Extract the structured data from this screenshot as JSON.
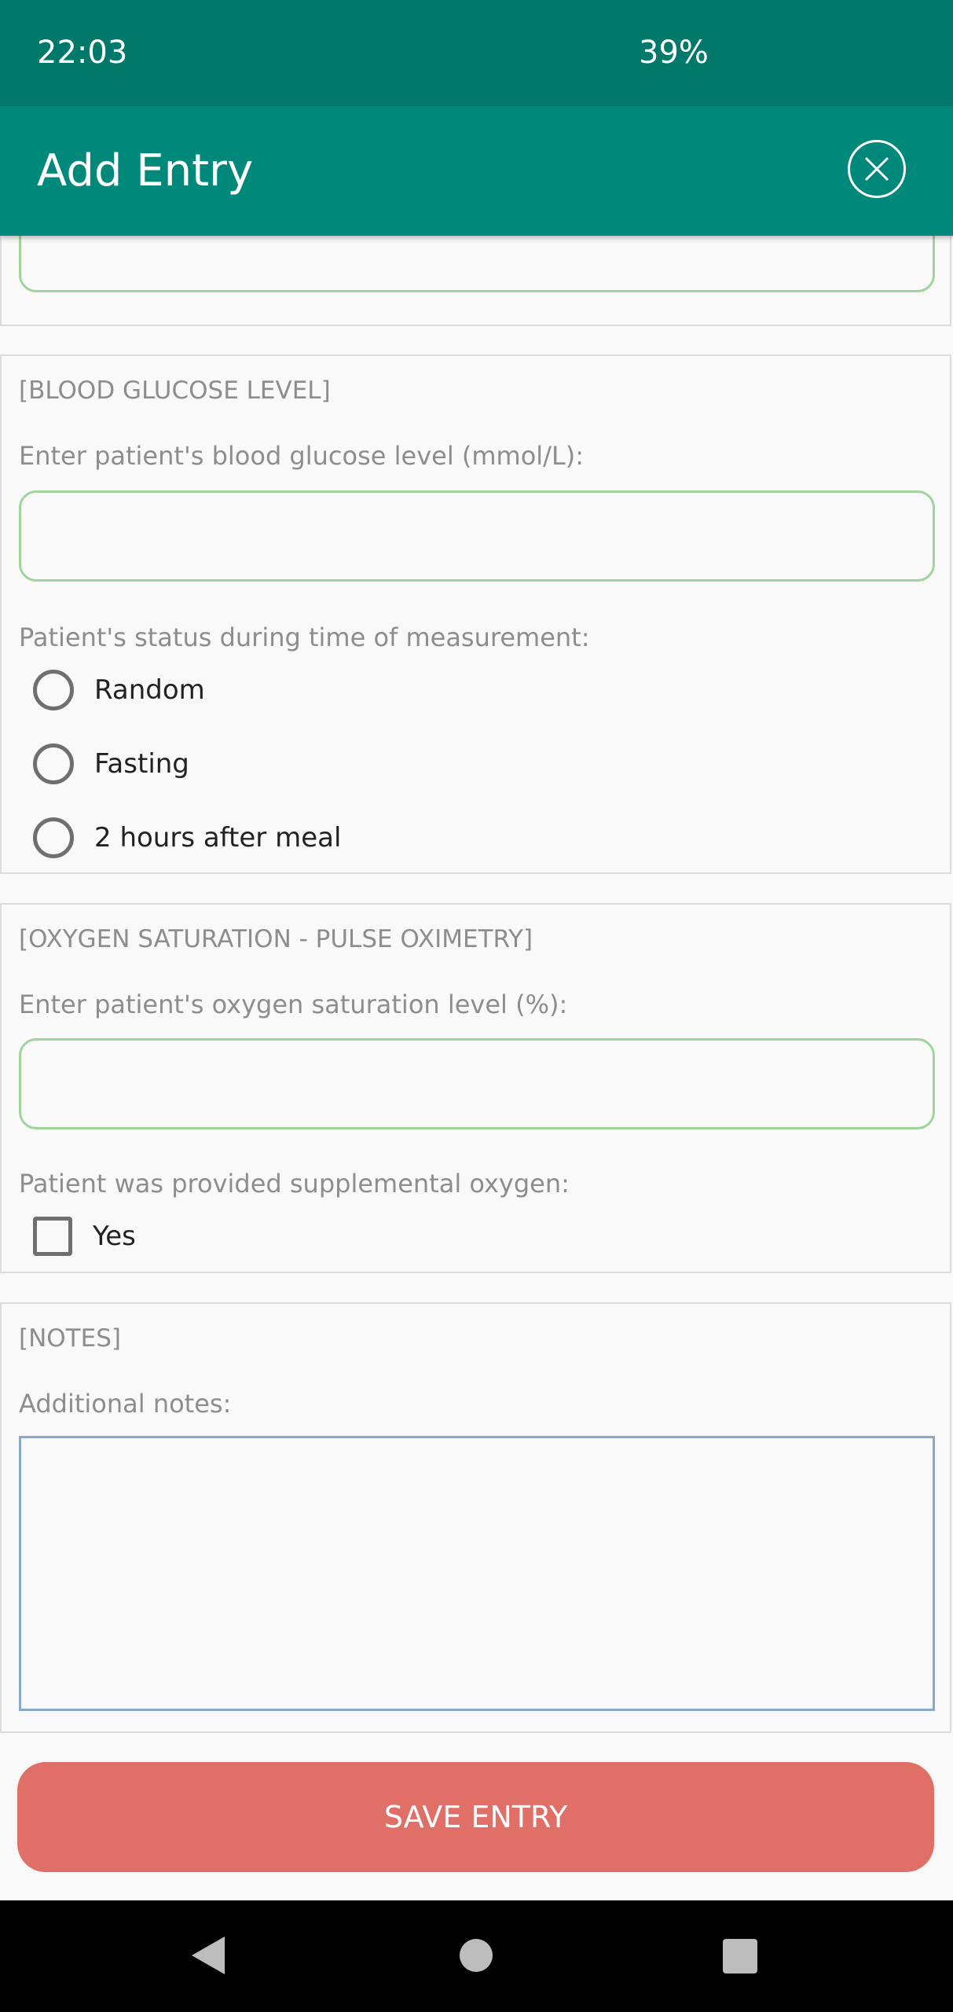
{
  "status_bar": {
    "time": "22:03",
    "battery": "39%"
  },
  "app_bar": {
    "title": "Add Entry",
    "close_icon": "close-circle-icon"
  },
  "blood_glucose": {
    "header": "[BLOOD GLUCOSE LEVEL]",
    "prompt": "Enter patient's blood glucose level (mmol/L):",
    "value": "",
    "status_label": "Patient's status during time of measurement:",
    "options": [
      "Random",
      "Fasting",
      "2 hours after meal"
    ]
  },
  "oxygen": {
    "header": "[OXYGEN SATURATION - PULSE OXIMETRY]",
    "prompt": "Enter patient's oxygen saturation level (%):",
    "value": "",
    "supplemental_label": "Patient was provided supplemental oxygen:",
    "yes_label": "Yes"
  },
  "notes": {
    "header": "[NOTES]",
    "prompt": "Additional notes:",
    "value": ""
  },
  "save_button": "SAVE ENTRY",
  "colors": {
    "status_bar": "#00796b",
    "app_bar": "#00897b",
    "field_border": "#9fd59c",
    "notes_border": "#8aa7cf",
    "save_button": "#e06f67"
  }
}
